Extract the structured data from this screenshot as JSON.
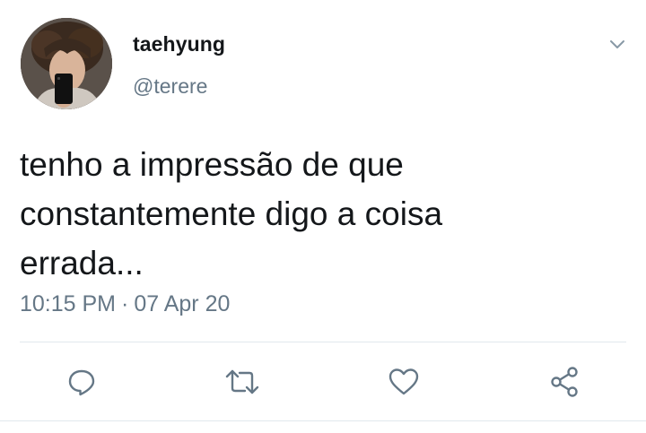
{
  "user": {
    "display_name": "taehyung",
    "handle": "@terere"
  },
  "tweet": {
    "text_lines": [
      "tenho a impressão de que",
      "constantemente digo a coisa",
      "errada..."
    ],
    "time": "10:15 PM",
    "separator": "·",
    "date": "07 Apr 20"
  },
  "icons": {
    "menu": "chevron-down-icon",
    "reply": "reply-icon",
    "retweet": "retweet-icon",
    "like": "heart-icon",
    "share": "share-icon"
  },
  "colors": {
    "text": "#14171a",
    "secondary": "#657786",
    "icon": "#657786",
    "divider": "#e1e8ed"
  }
}
